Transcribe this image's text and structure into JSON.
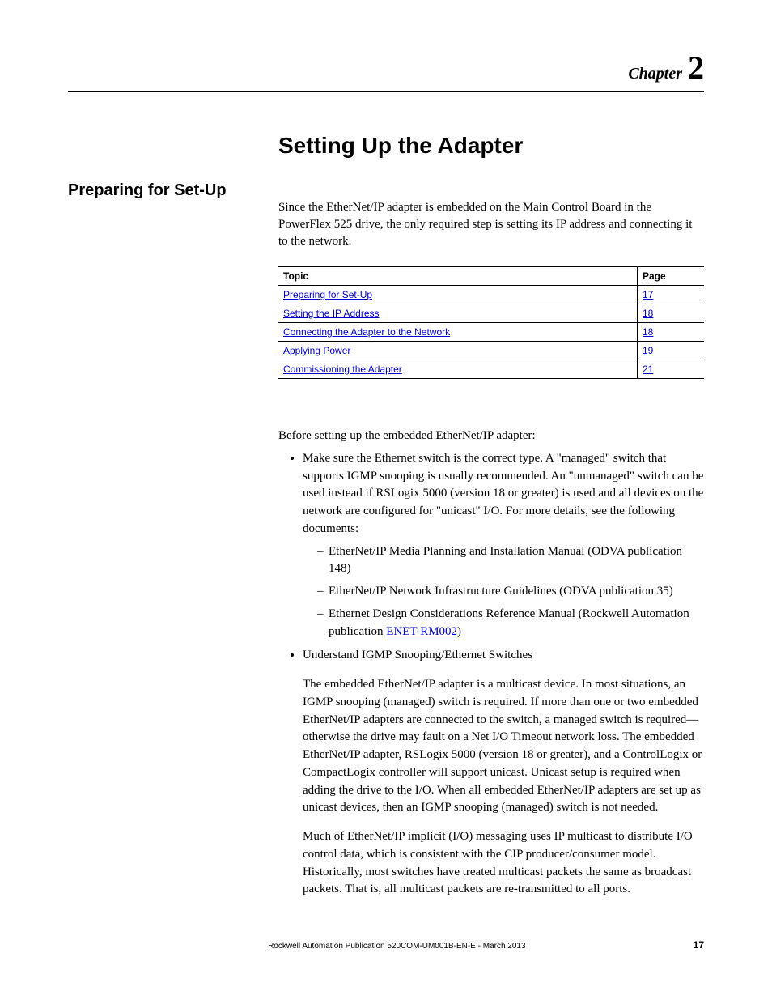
{
  "chapter": {
    "label": "Chapter",
    "number": "2"
  },
  "title": "Setting Up the Adapter",
  "intro": "Since the EtherNet/IP adapter is embedded on the Main Control Board in the PowerFlex 525 drive, the only required step is setting its IP address and connecting it to the network.",
  "table": {
    "headers": {
      "topic": "Topic",
      "page": "Page"
    },
    "rows": [
      {
        "topic": "Preparing for Set-Up",
        "page": "17"
      },
      {
        "topic": "Setting the IP Address",
        "page": "18"
      },
      {
        "topic": "Connecting the Adapter to the Network",
        "page": "18"
      },
      {
        "topic": "Applying Power",
        "page": "19"
      },
      {
        "topic": "Commissioning the Adapter",
        "page": "21"
      }
    ]
  },
  "section": {
    "heading": "Preparing for Set-Up",
    "lead": "Before setting up the embedded EtherNet/IP adapter:",
    "bullet1": "Make sure the Ethernet switch is the correct type. A \"managed\" switch that supports IGMP snooping is usually recommended. An \"unmanaged\" switch can be used instead if RSLogix 5000 (version 18 or greater) is used and all devices on the network are configured for \"unicast\" I/O. For more details, see the following documents:",
    "dash1a": "EtherNet/IP Media Planning and Installation Manual (ODVA publication 148)",
    "dash1b": "EtherNet/IP Network Infrastructure Guidelines (ODVA publication 35)",
    "dash1c_pre": "Ethernet Design Considerations Reference Manual (Rockwell Automation publication ",
    "dash1c_link": "ENET-RM002",
    "dash1c_post": ")",
    "bullet2": "Understand IGMP Snooping/Ethernet Switches",
    "para1": "The embedded EtherNet/IP adapter is a multicast device. In most situations, an IGMP snooping (managed) switch is required. If more than one or two embedded EtherNet/IP adapters are connected to the switch, a managed switch is required—otherwise the drive may fault on a Net I/O Timeout network loss. The embedded EtherNet/IP adapter, RSLogix 5000 (version 18 or greater), and a ControlLogix or CompactLogix controller will support unicast. Unicast setup is required when adding the drive to the I/O. When all embedded EtherNet/IP adapters are set up as unicast devices, then an IGMP snooping (managed) switch is not needed.",
    "para2": "Much of EtherNet/IP implicit (I/O) messaging uses IP multicast to distribute I/O control data, which is consistent with the CIP producer/consumer model. Historically, most switches have treated multicast packets the same as broadcast packets. That is, all multicast packets are re-transmitted to all ports."
  },
  "footer": {
    "publication": "Rockwell Automation Publication 520COM-UM001B-EN-E - March 2013",
    "page": "17"
  }
}
